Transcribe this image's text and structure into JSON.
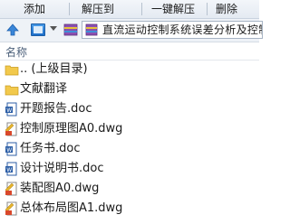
{
  "toolbar": {
    "add_label": "添加",
    "extract_label": "解压到",
    "one_click_label": "一键解压",
    "delete_label": "删除"
  },
  "address": {
    "path": "直流运动控制系统误差分析及控制"
  },
  "columns": {
    "name_header": "名称"
  },
  "files": [
    {
      "name": ".. (上级目录)",
      "icon": "folder-up-icon"
    },
    {
      "name": "文献翻译",
      "icon": "folder-icon"
    },
    {
      "name": "开题报告.doc",
      "icon": "doc-icon"
    },
    {
      "name": "控制原理图A0.dwg",
      "icon": "dwg-icon"
    },
    {
      "name": "任务书.doc",
      "icon": "doc-icon"
    },
    {
      "name": "设计说明书.doc",
      "icon": "doc-icon"
    },
    {
      "name": "装配图A0.dwg",
      "icon": "dwg-icon"
    },
    {
      "name": "总体布局图A1.dwg",
      "icon": "dwg-icon"
    }
  ]
}
